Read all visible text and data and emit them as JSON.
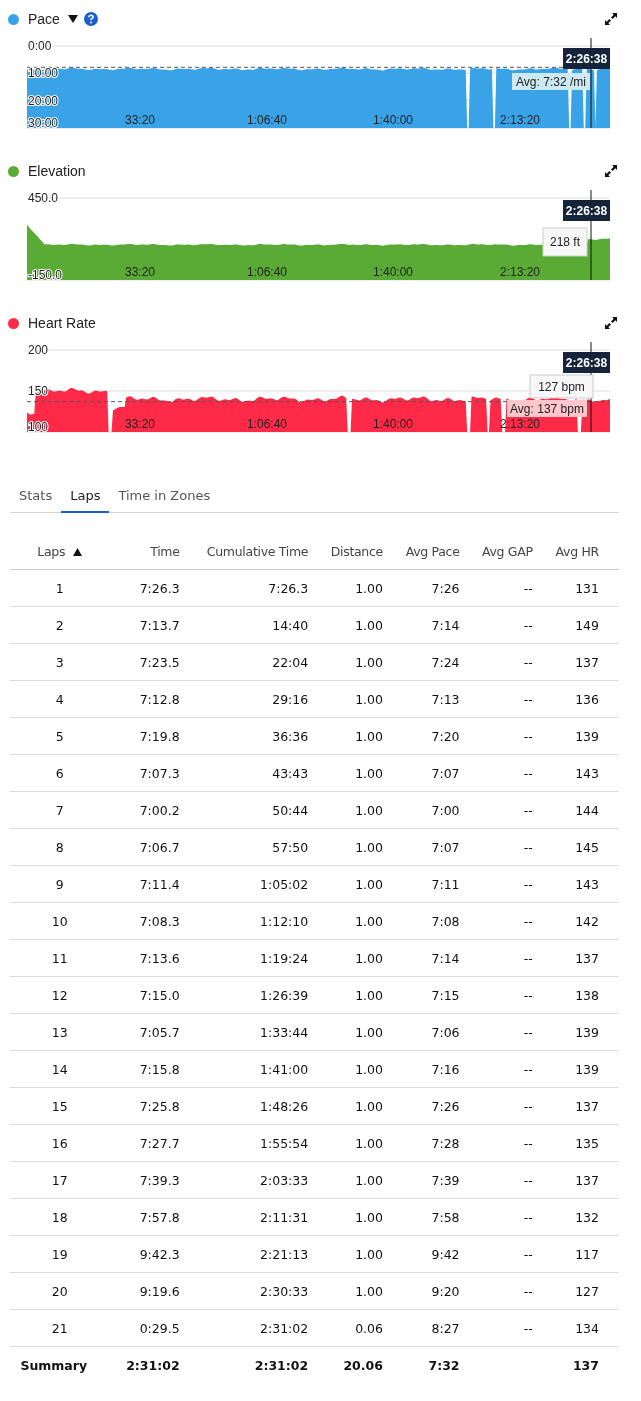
{
  "charts": [
    {
      "kind": "pace",
      "title": "Pace",
      "color": "#3aa3e8",
      "dropdown": true,
      "help": true,
      "y_labels": [
        "0:00",
        "10:00",
        "20:00",
        "30:00"
      ],
      "x_labels": [
        "33:20",
        "1:06:40",
        "1:40:00",
        "2:13:20"
      ],
      "cursor_time": "2:26:38",
      "avg_label": "Avg: 7:32 /mi"
    },
    {
      "kind": "elevation",
      "title": "Elevation",
      "color": "#5aab35",
      "y_labels": [
        "450.0",
        "-150.0"
      ],
      "x_labels": [
        "33:20",
        "1:06:40",
        "1:40:00",
        "2:13:20"
      ],
      "cursor_time": "2:26:38",
      "value_label": "218 ft"
    },
    {
      "kind": "heart",
      "title": "Heart Rate",
      "color": "#ff2a47",
      "y_labels": [
        "200",
        "150",
        "100"
      ],
      "x_labels": [
        "33:20",
        "1:06:40",
        "1:40:00",
        "2:13:20"
      ],
      "cursor_time": "2:26:38",
      "value_label": "127 bpm",
      "avg_label": "Avg: 137 bpm"
    }
  ],
  "tabs": [
    {
      "label": "Stats",
      "selected": false
    },
    {
      "label": "Laps",
      "selected": true
    },
    {
      "label": "Time in Zones",
      "selected": false
    }
  ],
  "table": {
    "columns": [
      {
        "label": "Laps",
        "sorted": true
      },
      {
        "label": "Time",
        "sorted": false
      },
      {
        "label": "Cumulative Time",
        "sorted": false
      },
      {
        "label": "Distance",
        "sorted": false
      },
      {
        "label": "Avg Pace",
        "sorted": false
      },
      {
        "label": "Avg GAP",
        "sorted": false
      },
      {
        "label": "Avg HR",
        "sorted": false
      }
    ],
    "rows": [
      [
        "1",
        "7:26.3",
        "7:26.3",
        "1.00",
        "7:26",
        "--",
        "131"
      ],
      [
        "2",
        "7:13.7",
        "14:40",
        "1.00",
        "7:14",
        "--",
        "149"
      ],
      [
        "3",
        "7:23.5",
        "22:04",
        "1.00",
        "7:24",
        "--",
        "137"
      ],
      [
        "4",
        "7:12.8",
        "29:16",
        "1.00",
        "7:13",
        "--",
        "136"
      ],
      [
        "5",
        "7:19.8",
        "36:36",
        "1.00",
        "7:20",
        "--",
        "139"
      ],
      [
        "6",
        "7:07.3",
        "43:43",
        "1.00",
        "7:07",
        "--",
        "143"
      ],
      [
        "7",
        "7:00.2",
        "50:44",
        "1.00",
        "7:00",
        "--",
        "144"
      ],
      [
        "8",
        "7:06.7",
        "57:50",
        "1.00",
        "7:07",
        "--",
        "145"
      ],
      [
        "9",
        "7:11.4",
        "1:05:02",
        "1.00",
        "7:11",
        "--",
        "143"
      ],
      [
        "10",
        "7:08.3",
        "1:12:10",
        "1.00",
        "7:08",
        "--",
        "142"
      ],
      [
        "11",
        "7:13.6",
        "1:19:24",
        "1.00",
        "7:14",
        "--",
        "137"
      ],
      [
        "12",
        "7:15.0",
        "1:26:39",
        "1.00",
        "7:15",
        "--",
        "138"
      ],
      [
        "13",
        "7:05.7",
        "1:33:44",
        "1.00",
        "7:06",
        "--",
        "139"
      ],
      [
        "14",
        "7:15.8",
        "1:41:00",
        "1.00",
        "7:16",
        "--",
        "139"
      ],
      [
        "15",
        "7:25.8",
        "1:48:26",
        "1.00",
        "7:26",
        "--",
        "137"
      ],
      [
        "16",
        "7:27.7",
        "1:55:54",
        "1.00",
        "7:28",
        "--",
        "135"
      ],
      [
        "17",
        "7:39.3",
        "2:03:33",
        "1.00",
        "7:39",
        "--",
        "137"
      ],
      [
        "18",
        "7:57.8",
        "2:11:31",
        "1.00",
        "7:58",
        "--",
        "132"
      ],
      [
        "19",
        "9:42.3",
        "2:21:13",
        "1.00",
        "9:42",
        "--",
        "117"
      ],
      [
        "20",
        "9:19.6",
        "2:30:33",
        "1.00",
        "9:20",
        "--",
        "127"
      ],
      [
        "21",
        "0:29.5",
        "2:31:02",
        "0.06",
        "8:27",
        "--",
        "134"
      ]
    ],
    "summary": {
      "label": "Summary",
      "time": "2:31:02",
      "cumulative_time": "2:31:02",
      "distance": "20.06",
      "avg_pace": "7:32",
      "avg_hr": "137"
    }
  }
}
